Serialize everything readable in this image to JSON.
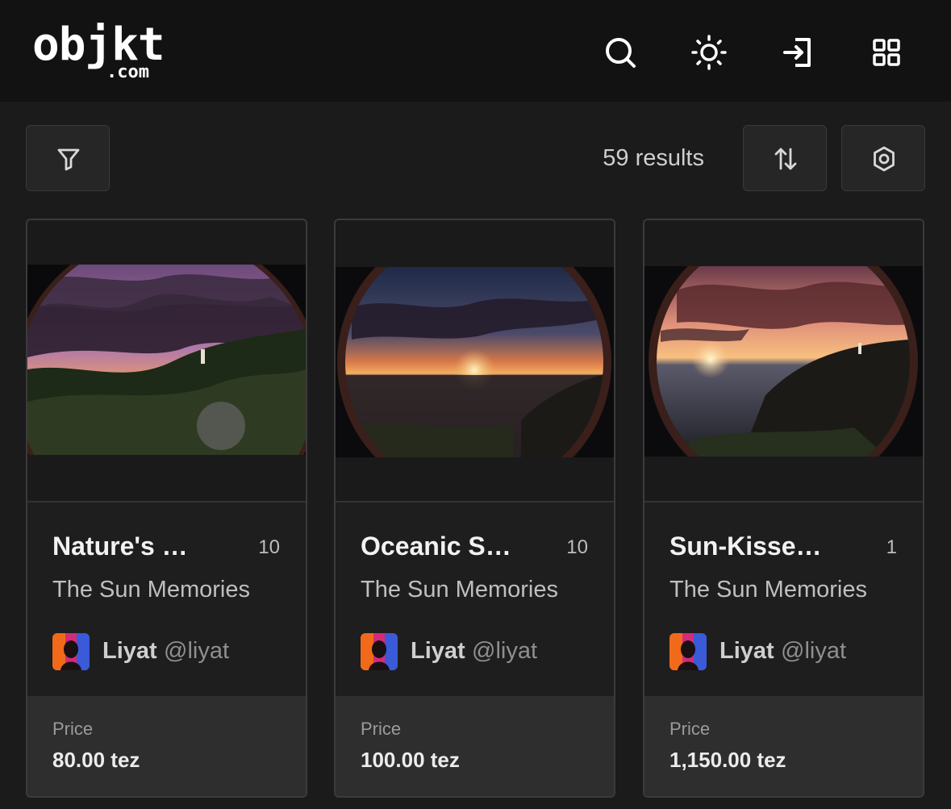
{
  "header": {
    "logo_main": "objkt",
    "logo_sub": ".com",
    "icons": [
      "search-icon",
      "theme-sun-icon",
      "login-icon",
      "grid-menu-icon"
    ]
  },
  "toolbar": {
    "results_text": "59 results",
    "icons": [
      "filter-icon",
      "sort-icon",
      "settings-icon"
    ]
  },
  "colors": {
    "background": "#1b1b1b",
    "header": "#121212",
    "card": "#1e1e1e",
    "price_panel": "#2e2e2e",
    "text": "#e6e6e6"
  },
  "cards": [
    {
      "title": "Nature's …",
      "editions": "10",
      "collection": "The Sun Memories",
      "artist_name": "Liyat",
      "artist_handle": "@liyat",
      "price_label": "Price",
      "price_value": "80.00 tez"
    },
    {
      "title": "Oceanic S…",
      "editions": "10",
      "collection": "The Sun Memories",
      "artist_name": "Liyat",
      "artist_handle": "@liyat",
      "price_label": "Price",
      "price_value": "100.00 tez"
    },
    {
      "title": "Sun-Kisse…",
      "editions": "1",
      "collection": "The Sun Memories",
      "artist_name": "Liyat",
      "artist_handle": "@liyat",
      "price_label": "Price",
      "price_value": "1,150.00 tez"
    }
  ]
}
